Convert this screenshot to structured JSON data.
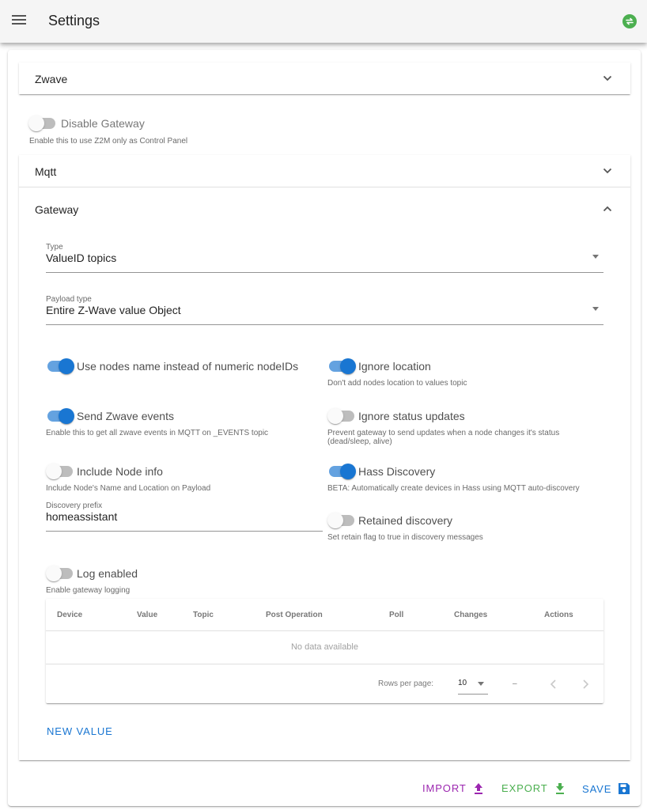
{
  "header": {
    "title": "Settings",
    "menu_icon": "menu-icon",
    "status_icon": "sync-status-icon",
    "status_color": "#4caf50"
  },
  "panels": {
    "zwave": {
      "label": "Zwave",
      "expanded": false
    },
    "mqtt": {
      "label": "Mqtt",
      "expanded": false
    },
    "gateway": {
      "label": "Gateway",
      "expanded": true
    }
  },
  "disable_gateway": {
    "label": "Disable Gateway",
    "hint": "Enable this to use Z2M only as Control Panel",
    "checked": false
  },
  "gateway": {
    "type": {
      "label": "Type",
      "value": "ValueID topics"
    },
    "payload_type": {
      "label": "Payload type",
      "value": "Entire Z-Wave value Object"
    },
    "toggles": {
      "use_nodes_name": {
        "label": "Use nodes name instead of numeric nodeIDs",
        "checked": true
      },
      "ignore_location": {
        "label": "Ignore location",
        "hint": "Don't add nodes location to values topic",
        "checked": true
      },
      "send_events": {
        "label": "Send Zwave events",
        "hint": "Enable this to get all zwave events in MQTT on _EVENTS topic",
        "checked": true
      },
      "ignore_status": {
        "label": "Ignore status updates",
        "hint": "Prevent gateway to send updates when a node changes it's status (dead/sleep, alive)",
        "checked": false
      },
      "include_node_info": {
        "label": "Include Node info",
        "hint": "Include Node's Name and Location on Payload",
        "checked": false
      },
      "hass_discovery": {
        "label": "Hass Discovery",
        "hint": "BETA: Automatically create devices in Hass using MQTT auto-discovery",
        "checked": true
      },
      "retained_discovery": {
        "label": "Retained discovery",
        "hint": "Set retain flag to true in discovery messages",
        "checked": false
      },
      "log_enabled": {
        "label": "Log enabled",
        "hint": "Enable gateway logging",
        "checked": false
      }
    },
    "discovery_prefix": {
      "label": "Discovery prefix",
      "value": "homeassistant"
    },
    "table": {
      "headers": [
        "Device",
        "Value",
        "Topic",
        "Post Operation",
        "Poll",
        "Changes",
        "Actions"
      ],
      "empty_text": "No data available",
      "rows_per_page_label": "Rows per page:",
      "rows_per_page_value": "10",
      "page_range": "–"
    },
    "new_value_label": "New Value"
  },
  "footer": {
    "import_label": "Import",
    "export_label": "Export",
    "save_label": "Save",
    "import_color": "#9c27b0",
    "export_color": "#4caf50",
    "save_color": "#1976d2"
  },
  "colors": {
    "primary": "#1976d2",
    "switch_track_on": "#64a2e0"
  }
}
